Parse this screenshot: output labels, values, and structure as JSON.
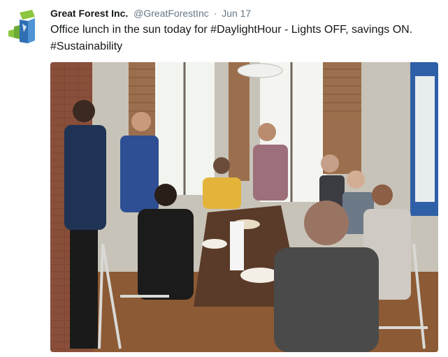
{
  "tweet": {
    "display_name": "Great Forest Inc.",
    "handle": "@GreatForestInc",
    "separator": "·",
    "date": "Jun 17",
    "text_parts": [
      "Office lunch in the sun today for ",
      "#DaylightHour",
      " - Lights OFF, savings ON. ",
      "#Sustainability"
    ],
    "avatar_icon": "great-forest-logo-icon",
    "media_alt": "Office staff gathered around a lunch table by sunny windows"
  },
  "colors": {
    "name": "#14171a",
    "meta": "#657786",
    "logo_green": "#8cc63f",
    "logo_blue": "#2f6fb4"
  }
}
